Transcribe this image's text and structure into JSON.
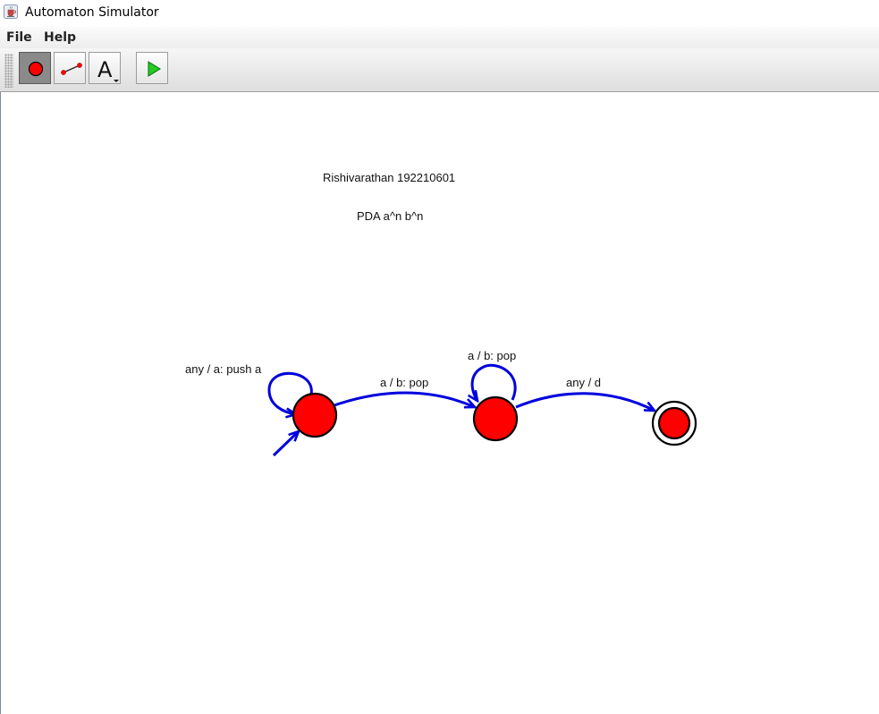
{
  "window": {
    "title": "Automaton Simulator",
    "icon": "java-cup-icon"
  },
  "menubar": {
    "items": [
      {
        "label": "File"
      },
      {
        "label": "Help"
      }
    ]
  },
  "toolbar": {
    "tools": [
      {
        "name": "state-tool",
        "icon": "red-circle-icon",
        "selected": true
      },
      {
        "name": "transition-tool",
        "icon": "transition-line-icon",
        "selected": false
      },
      {
        "name": "text-tool",
        "icon": "text-a-dropdown-icon",
        "glyph": "A",
        "selected": false
      },
      {
        "name": "run-tool",
        "icon": "play-triangle-icon",
        "selected": false
      }
    ]
  },
  "canvas": {
    "texts": {
      "author": "Rishivarathan 192210601",
      "machine": "PDA a^n b^n"
    },
    "states": [
      {
        "id": "q0",
        "initial": true,
        "final": false
      },
      {
        "id": "q1",
        "initial": false,
        "final": false
      },
      {
        "id": "q2",
        "initial": false,
        "final": true
      }
    ],
    "transitions": [
      {
        "from": "q0",
        "to": "q0",
        "label": "any / a: push a"
      },
      {
        "from": "q0",
        "to": "q1",
        "label": "a / b: pop"
      },
      {
        "from": "q1",
        "to": "q1",
        "label": "a / b: pop"
      },
      {
        "from": "q1",
        "to": "q2",
        "label": "any / d"
      }
    ]
  },
  "colors": {
    "state_fill": "#ff0000",
    "state_stroke": "#000000",
    "transition": "#0000dd",
    "selected_tool": "#8a8a8a",
    "play_green": "#22cc22"
  }
}
